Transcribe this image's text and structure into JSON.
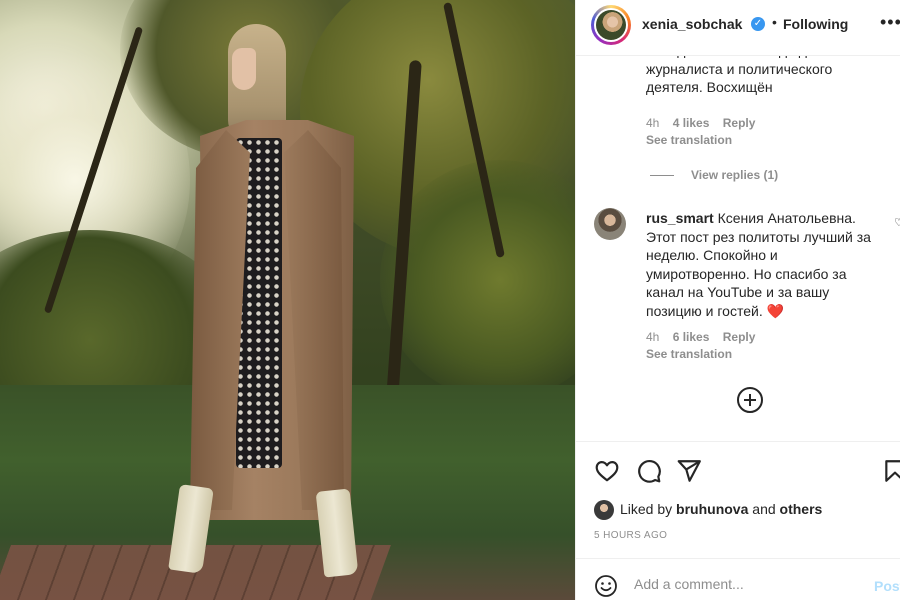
{
  "header": {
    "username": "xenia_sobchak",
    "verified_icon": "verified-badge-icon",
    "separator": "•",
    "follow_status": "Following",
    "more_icon": "more-options-icon",
    "more_glyph": "•••"
  },
  "comments": [
    {
      "text": "блондинки в шоколаде до журналиста и политического деятеля. Восхищён",
      "time": "4h",
      "likes": "4 likes",
      "reply": "Reply",
      "see_translation": "See translation"
    },
    {
      "username": "rus_smart",
      "text": "Ксения Анатольевна. Этот пост рез политоты лучший за неделю. Спокойно и умиротворенно. Но спасибо за канал на YouTube и за вашу позицию и гостей.",
      "emoji": "❤️",
      "time": "4h",
      "likes": "6 likes",
      "reply": "Reply",
      "see_translation": "See translation"
    }
  ],
  "view_replies": "View replies (1)",
  "load_more_icon": "add-circle-icon",
  "actions": {
    "like_icon": "heart-icon",
    "comment_icon": "comment-icon",
    "share_icon": "send-icon",
    "save_icon": "bookmark-icon"
  },
  "likes": {
    "prefix": "Liked by",
    "user": "bruhunova",
    "and": "and",
    "others": "others"
  },
  "time_ago": "5 HOURS AGO",
  "composer": {
    "emoji_icon": "emoji-icon",
    "placeholder": "Add a comment...",
    "post_label": "Post"
  },
  "colors": {
    "text": "#262626",
    "muted": "#8e8e8e",
    "verified": "#3897f0",
    "post_disabled": "#b2dffc",
    "border": "#efefef"
  }
}
